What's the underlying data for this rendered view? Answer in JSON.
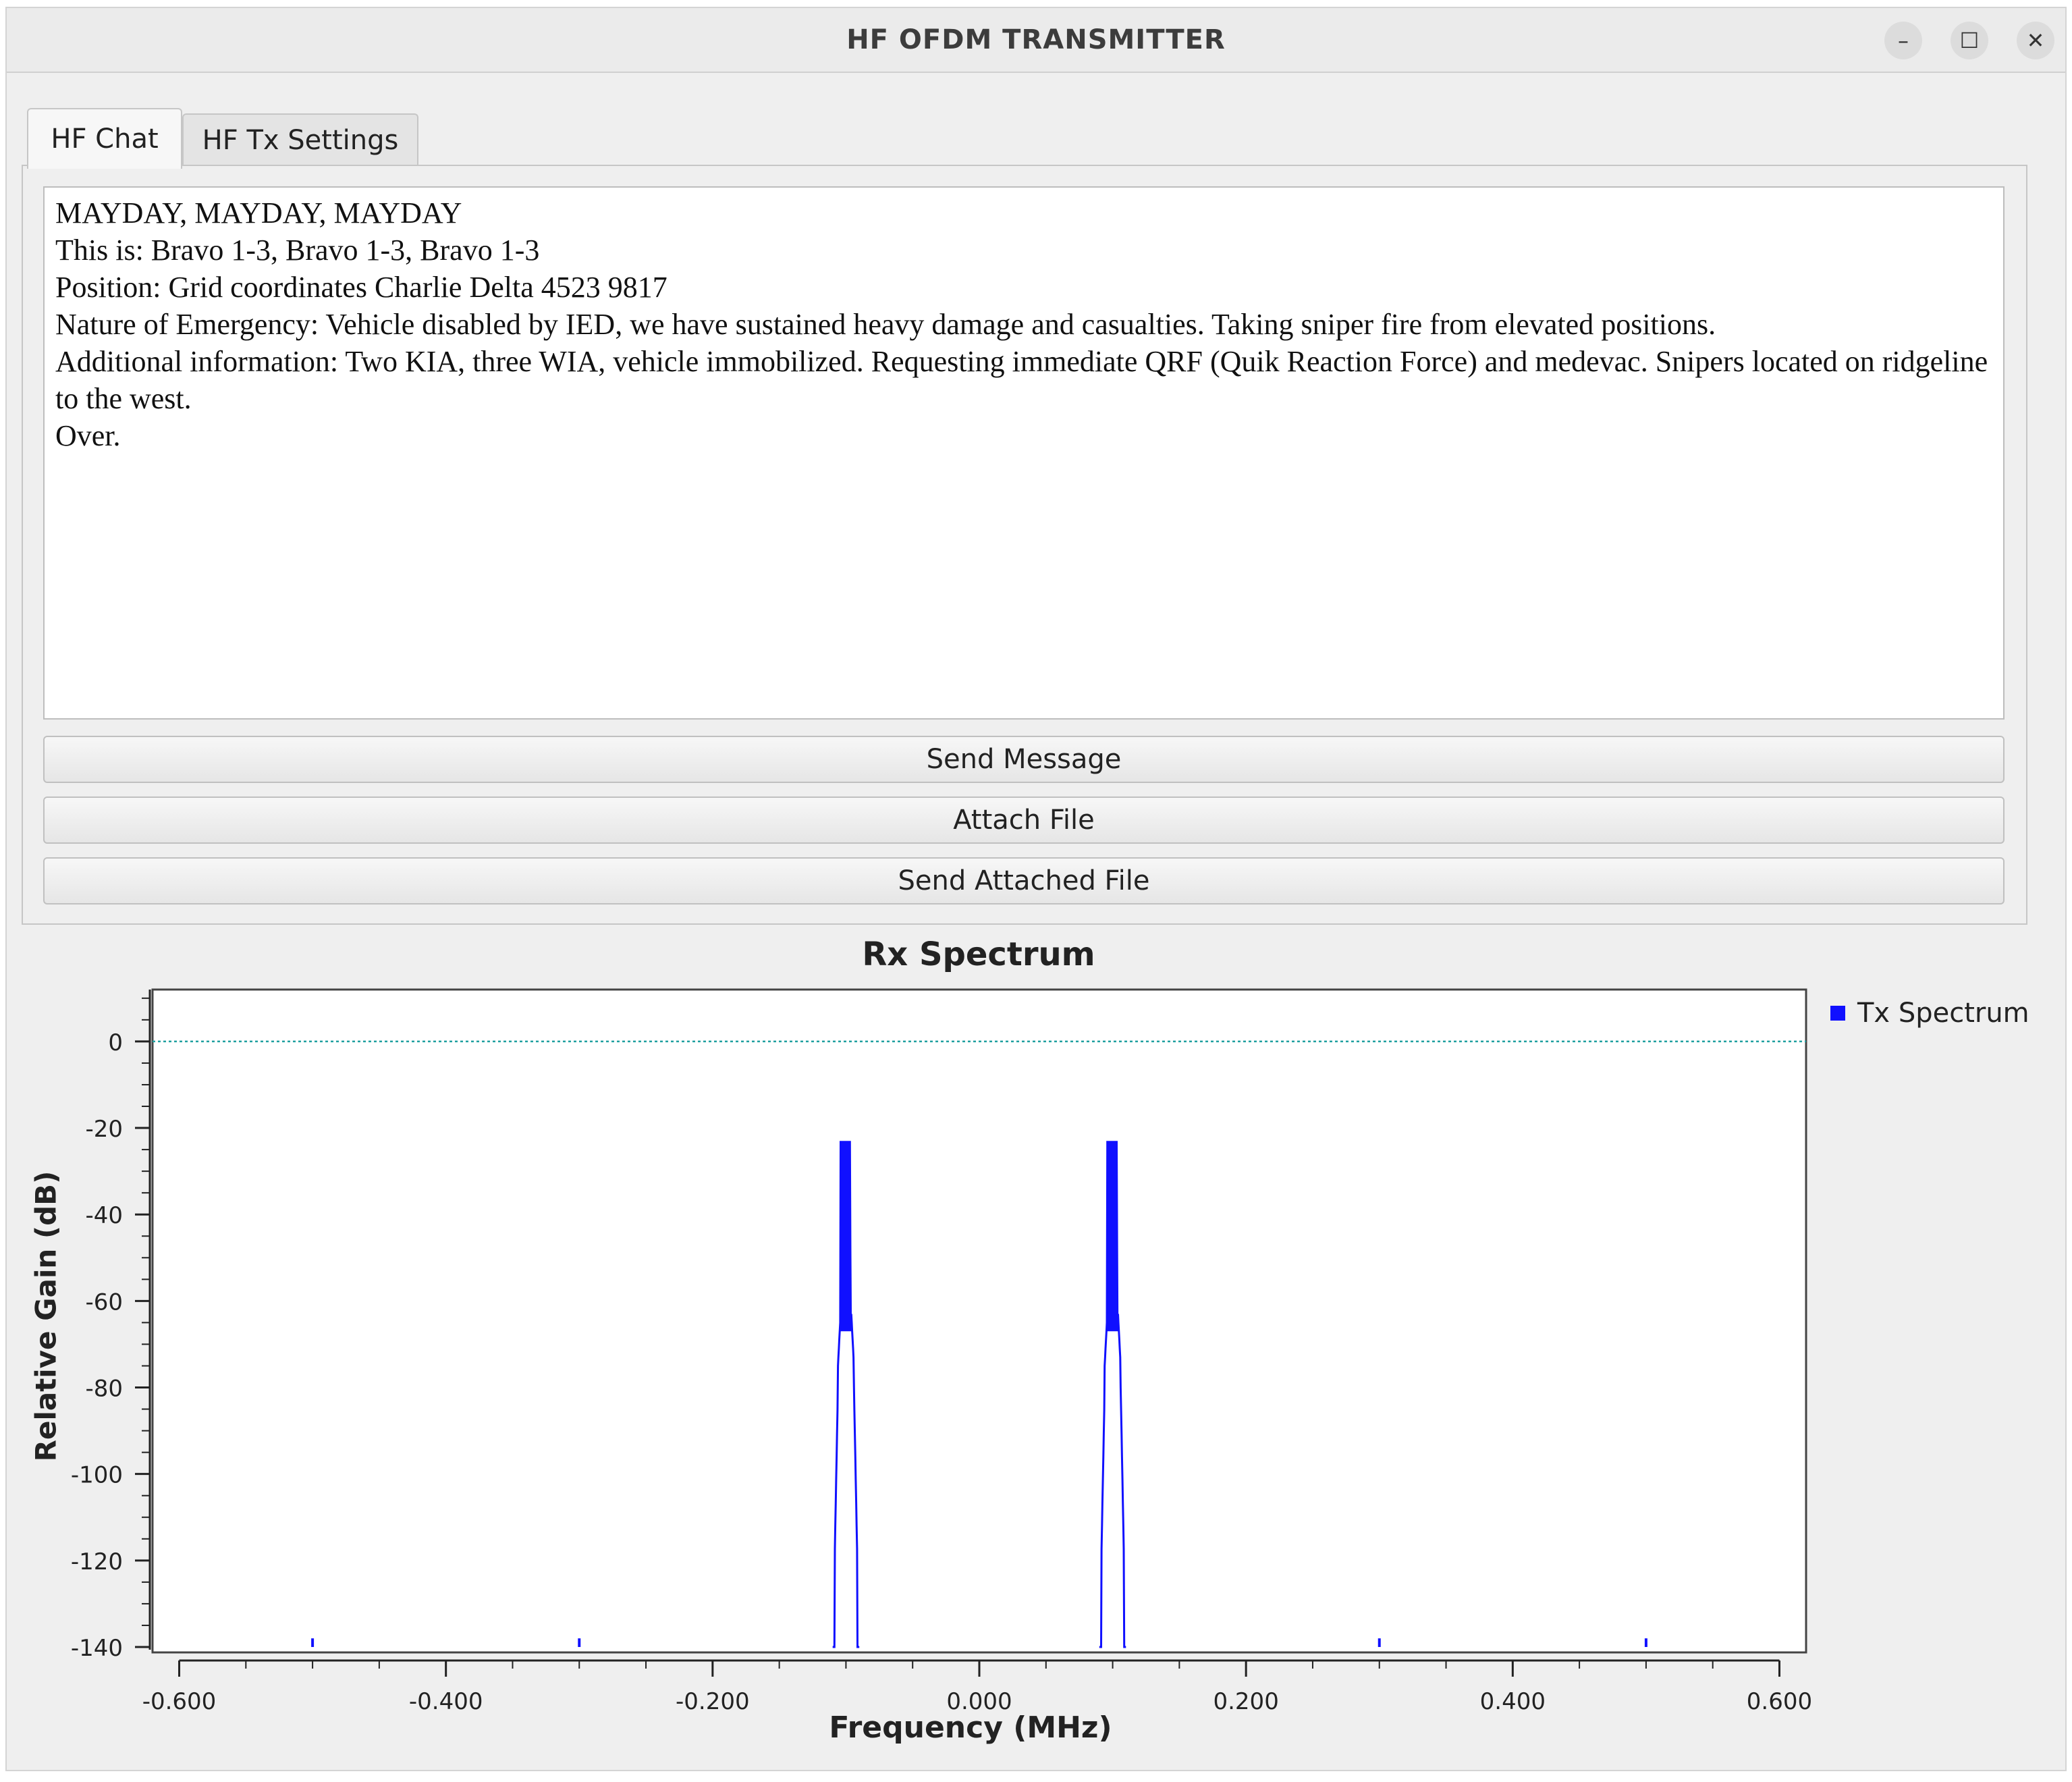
{
  "window": {
    "title": "HF OFDM TRANSMITTER",
    "controls": {
      "minimize": "–",
      "maximize": "☐",
      "close": "✕"
    }
  },
  "tabs": [
    {
      "label": "HF Chat",
      "active": true
    },
    {
      "label": "HF Tx Settings",
      "active": false
    }
  ],
  "chat": {
    "message_lines": [
      "MAYDAY, MAYDAY, MAYDAY",
      "This is: Bravo 1-3, Bravo 1-3, Bravo 1-3",
      "Position: Grid coordinates Charlie Delta 4523 9817",
      "Nature of Emergency: Vehicle disabled by IED, we have sustained heavy damage and casualties. Taking sniper fire from elevated positions.",
      "Additional information: Two KIA, three WIA, vehicle immobilized. Requesting immediate QRF (Quik Reaction Force) and medevac. Snipers located on ridgeline to the west.",
      "Over."
    ],
    "buttons": {
      "send_message": "Send Message",
      "attach_file": "Attach File",
      "send_attached_file": "Send Attached File"
    }
  },
  "chart_data": {
    "type": "line",
    "title": "Rx Spectrum",
    "xlabel": "Frequency (MHz)",
    "ylabel": "Relative Gain (dB)",
    "xlim": [
      -0.62,
      0.62
    ],
    "ylim": [
      -140,
      12
    ],
    "x_ticks": [
      "-0.600",
      "-0.400",
      "-0.200",
      "0.000",
      "0.200",
      "0.400",
      "0.600"
    ],
    "y_ticks": [
      "0",
      "-20",
      "-40",
      "-60",
      "-80",
      "-100",
      "-120",
      "-140"
    ],
    "reference_line_db": 0,
    "series": [
      {
        "name": "Tx Spectrum",
        "color": "#1010ff",
        "peaks": [
          {
            "center_mhz": -0.1,
            "peak_db": -23,
            "width_mhz": 0.02
          },
          {
            "center_mhz": 0.1,
            "peak_db": -23,
            "width_mhz": 0.02
          }
        ],
        "spurs_mhz": [
          -0.5,
          -0.3,
          0.3,
          0.5
        ],
        "spur_db": -138
      }
    ],
    "legend_position": "top-right",
    "reference_line_color": "#20a0a0"
  }
}
